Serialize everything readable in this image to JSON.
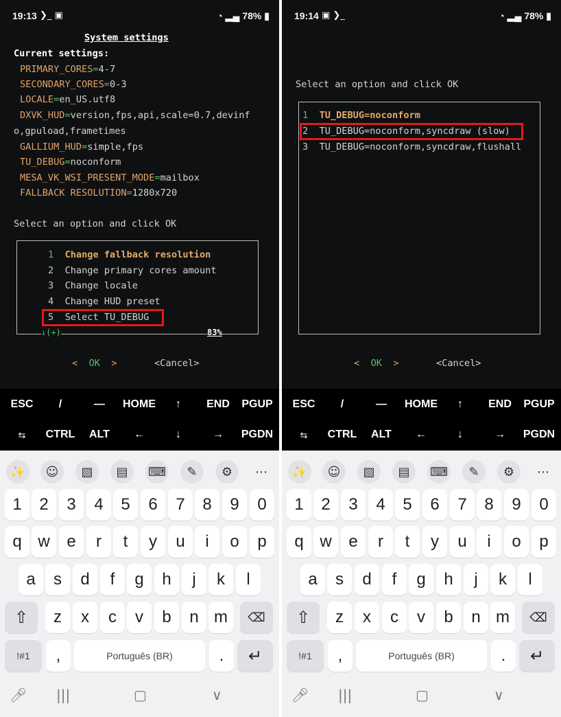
{
  "left": {
    "status": {
      "time": "19:13",
      "indicators": "❯_ ▣",
      "battery": "78%"
    },
    "title": "System settings",
    "current_label": "Current settings:",
    "settings": [
      {
        "key": "PRIMARY_CORES",
        "eq": "=",
        "value": "4-7"
      },
      {
        "key": "SECONDARY_CORES",
        "eq": "=",
        "value": "0-3"
      },
      {
        "key": "LOCALE",
        "eq": "=",
        "value": "en_US.utf8"
      },
      {
        "key": "DXVK_HUD",
        "eq": "=",
        "value": "version,fps,api,scale=0.7,devinf"
      },
      {
        "key": "",
        "eq": "",
        "value": "o,gpuload,frametimes"
      },
      {
        "key": "GALLIUM_HUD",
        "eq": "=",
        "value": "simple,fps"
      },
      {
        "key": "TU_DEBUG",
        "eq": "=",
        "value": "noconform"
      },
      {
        "key": "MESA_VK_WSI_PRESENT_MODE",
        "eq": "=",
        "value": "mailbox"
      },
      {
        "key": "FALLBACK RESOLUTION",
        "eq": "=",
        "value": "1280x720"
      }
    ],
    "prompt": "Select an option and click OK",
    "menu": [
      {
        "num": "1",
        "label": "Change fallback resolution",
        "selected": true
      },
      {
        "num": "2",
        "label": "Change primary cores amount",
        "selected": false
      },
      {
        "num": "3",
        "label": "Change locale",
        "selected": false
      },
      {
        "num": "4",
        "label": "Change HUD preset",
        "selected": false
      },
      {
        "num": "5",
        "label": "Select TU_DEBUG",
        "selected": false
      }
    ],
    "scroll_hint": "↓(+)",
    "scroll_percent": "83%",
    "ok": {
      "lt": "<",
      "label": "OK",
      "gt": ">"
    },
    "cancel": "<Cancel>"
  },
  "right": {
    "status": {
      "time": "19:14",
      "indicators": "▣ ❯_",
      "battery": "78%"
    },
    "prompt": "Select an option and click OK",
    "menu": [
      {
        "num": "1",
        "label": "TU_DEBUG=noconform",
        "selected": true
      },
      {
        "num": "2",
        "label": "TU_DEBUG=noconform,syncdraw (slow)",
        "selected": false
      },
      {
        "num": "3",
        "label": "TU_DEBUG=noconform,syncdraw,flushall",
        "selected": false
      }
    ],
    "ok": {
      "lt": "<",
      "label": "OK",
      "gt": ">"
    },
    "cancel": "<Cancel>"
  },
  "extra_keys": {
    "row1": [
      "ESC",
      "/",
      "—",
      "HOME",
      "↑",
      "END",
      "PGUP"
    ],
    "row2": [
      "⇆",
      "CTRL",
      "ALT",
      "←",
      "↓",
      "→",
      "PGDN"
    ]
  },
  "keyboard": {
    "toolbar_icons": [
      "ai-sparkle-icon",
      "emoji-icon",
      "sticker-icon",
      "clipboard-icon",
      "keyboard-mode-icon",
      "handwriting-icon",
      "settings-icon",
      "more-icon"
    ],
    "numbers": [
      "1",
      "2",
      "3",
      "4",
      "5",
      "6",
      "7",
      "8",
      "9",
      "0"
    ],
    "row1": [
      "q",
      "w",
      "e",
      "r",
      "t",
      "y",
      "u",
      "i",
      "o",
      "p"
    ],
    "row2": [
      "a",
      "s",
      "d",
      "f",
      "g",
      "h",
      "j",
      "k",
      "l"
    ],
    "row3": [
      "z",
      "x",
      "c",
      "v",
      "b",
      "n",
      "m"
    ],
    "symbols": "!#1",
    "comma": ",",
    "space": "Português (BR)",
    "period": "."
  },
  "colors": {
    "highlight": "#e11a1a",
    "setting_key": "#e1a46a",
    "accent_green": "#58c06b",
    "terminal_bg": "#0f1011"
  }
}
